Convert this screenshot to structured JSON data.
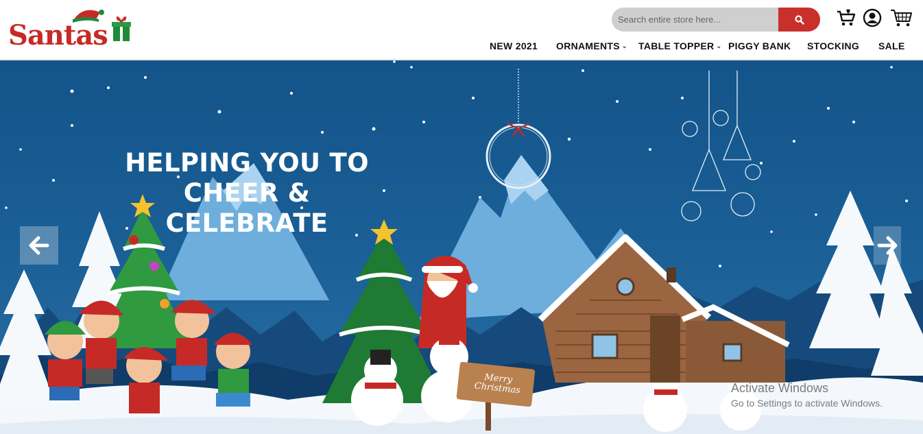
{
  "header": {
    "logo_text": "Santas",
    "search": {
      "placeholder": "Search entire store here..."
    },
    "icons": [
      "cart-heart-icon",
      "account-icon",
      "cart-icon"
    ],
    "accent_color": "#c9302c"
  },
  "nav": {
    "items": [
      {
        "label": "NEW 2021",
        "has_dropdown": false
      },
      {
        "label": "ORNAMENTS",
        "has_dropdown": true
      },
      {
        "label": "TABLE TOPPER",
        "has_dropdown": true
      },
      {
        "label": "PIGGY BANK",
        "has_dropdown": false
      },
      {
        "label": "STOCKING",
        "has_dropdown": false
      },
      {
        "label": "SALE",
        "has_dropdown": false
      }
    ]
  },
  "hero": {
    "title_line1": "HELPING YOU TO",
    "title_line2": "CHEER & CELEBRATE",
    "sign_text": "Merry Christmas",
    "prev_icon": "arrow-left-icon",
    "next_icon": "arrow-right-icon"
  },
  "watermark": {
    "title": "Activate Windows",
    "subtitle": "Go to Settings to activate Windows."
  }
}
